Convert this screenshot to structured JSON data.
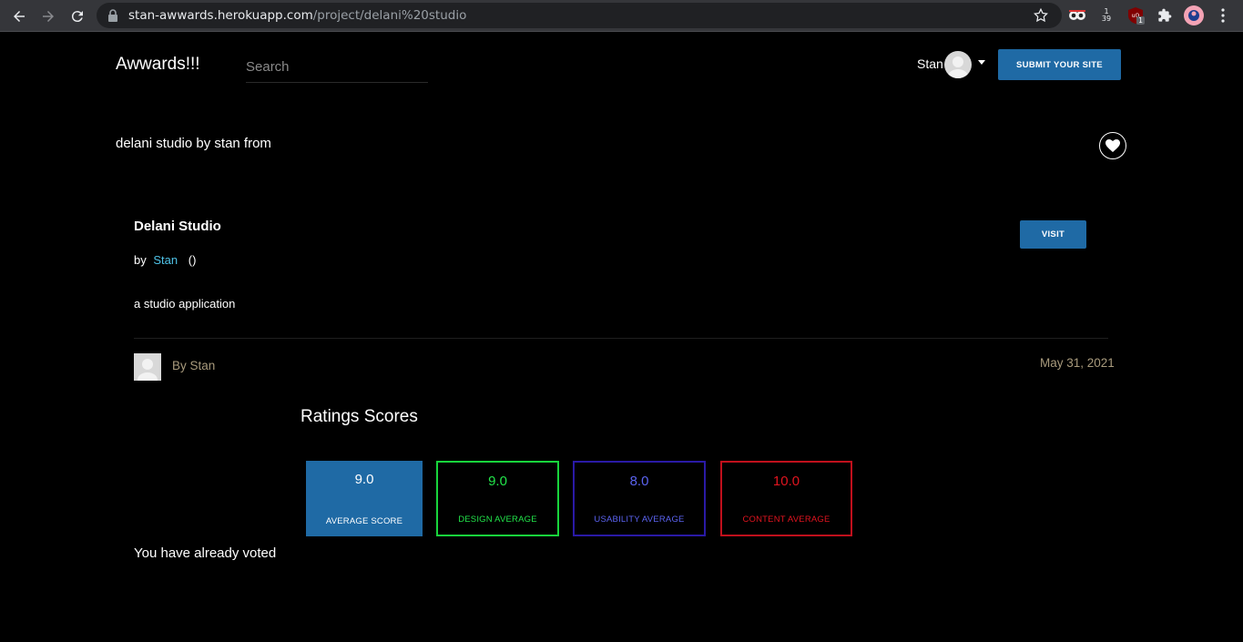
{
  "browser": {
    "url_host": "stan-awwards.herokuapp.com",
    "url_path": "/project/delani%20studio",
    "extensions": [
      {
        "name": "eyes-icon"
      },
      {
        "name": "counter-icon",
        "text_top": "1",
        "text_bottom": "39"
      },
      {
        "name": "ublock-icon",
        "badge": "1"
      },
      {
        "name": "puzzle-icon"
      },
      {
        "name": "profile-avatar-icon"
      },
      {
        "name": "kebab-menu-icon"
      }
    ]
  },
  "header": {
    "brand": "Awwards!!!",
    "search_placeholder": "Search",
    "user_name": "Stan",
    "submit_label": "SUBMIT YOUR SITE"
  },
  "project": {
    "heading": "delani studio by stan from",
    "title": "Delani Studio",
    "by_prefix": "by",
    "author": "Stan",
    "location": "()",
    "visit_label": "VISIT",
    "description": "a studio application",
    "post_author": "By Stan",
    "post_date": "May 31, 2021"
  },
  "ratings": {
    "title": "Ratings Scores",
    "average": {
      "value": "9.0",
      "label": "AVERAGE SCORE"
    },
    "design": {
      "value": "9.0",
      "label": "DESIGN AVERAGE"
    },
    "usability": {
      "value": "8.0",
      "label": "USABILITY AVERAGE"
    },
    "content": {
      "value": "10.0",
      "label": "CONTENT AVERAGE"
    },
    "voted_message": "You have already voted"
  },
  "colors": {
    "background": "#000000",
    "accent_blue": "#1f6aa5",
    "link": "#4fc3e8",
    "design": "#22e44a",
    "usability": "#5b63f0",
    "content": "#e0141f",
    "meta_text": "#a89a7c"
  }
}
